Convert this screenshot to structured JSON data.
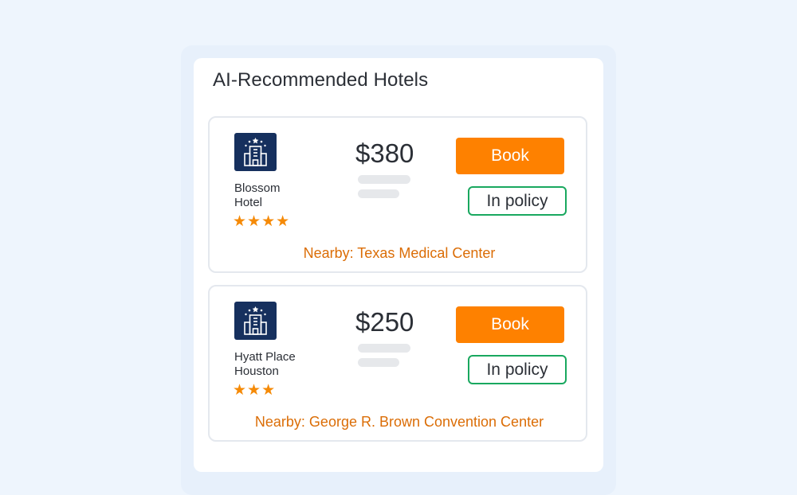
{
  "panel": {
    "title": "AI-Recommended Hotels"
  },
  "hotels": [
    {
      "name_line1": "Blossom",
      "name_line2": "Hotel",
      "stars": "★★★★",
      "star_count": 4,
      "price": "$380",
      "book_label": "Book",
      "policy_label": "In policy",
      "nearby": "Nearby: Texas Medical Center"
    },
    {
      "name_line1": "Hyatt Place",
      "name_line2": "Houston",
      "stars": "★★★",
      "star_count": 3,
      "price": "$250",
      "book_label": "Book",
      "policy_label": "In policy",
      "nearby": "Nearby: George R. Brown Convention Center"
    }
  ],
  "icons": {
    "hotel": "hotel-building-icon",
    "star": "star-icon"
  },
  "colors": {
    "page_background": "#eef5fd",
    "book_button": "#fe8100",
    "policy_border": "#19a85f",
    "nearby_text": "#db6d06",
    "stars": "#f58a07",
    "hotel_icon_background": "#16305e"
  }
}
